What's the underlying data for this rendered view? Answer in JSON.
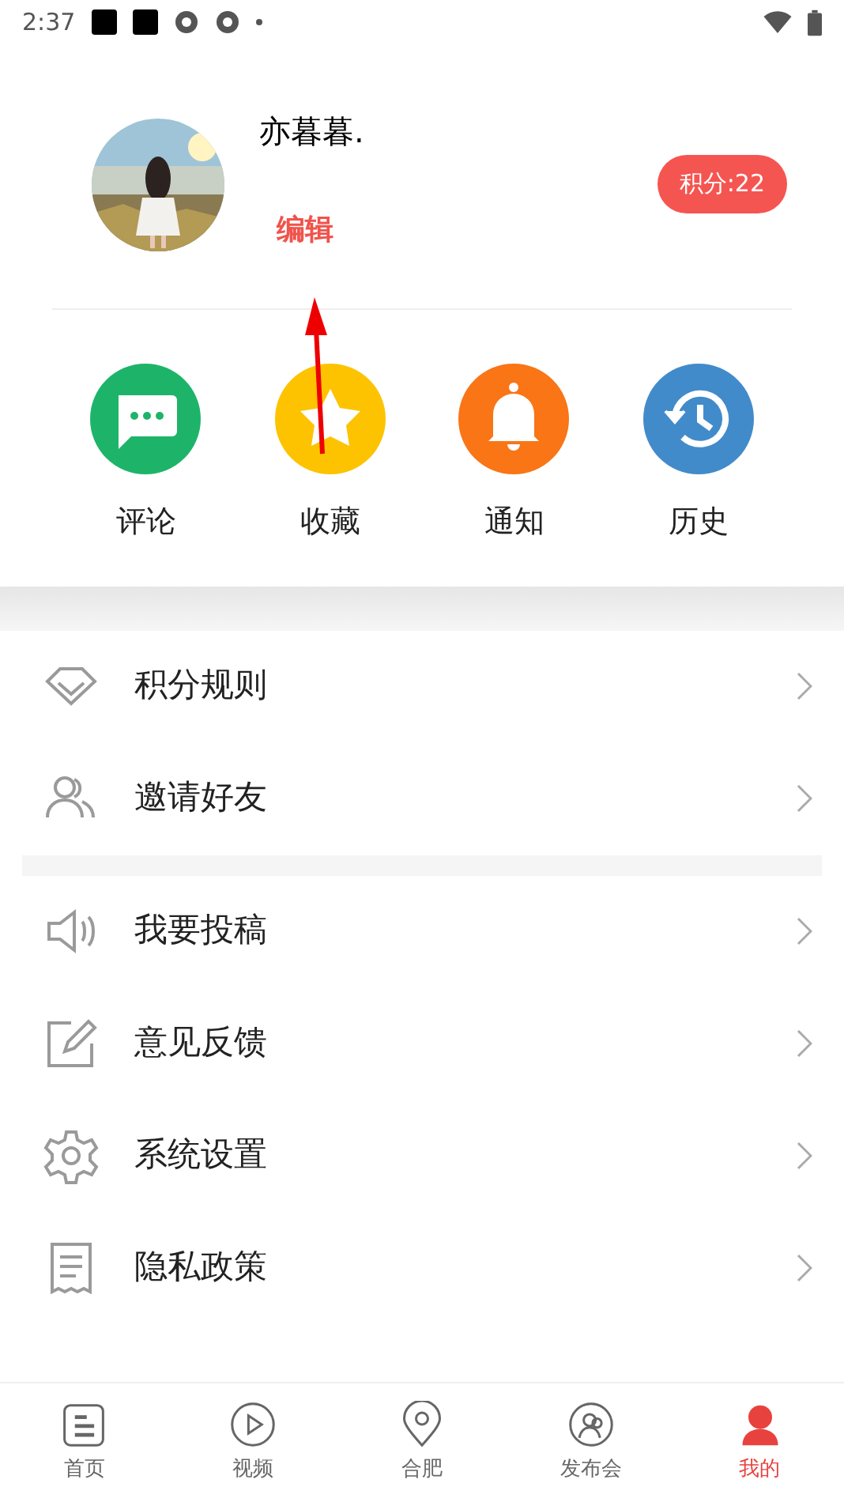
{
  "status_bar": {
    "time": "2:37"
  },
  "profile": {
    "name": "亦暮暮.",
    "edit_link": "编辑",
    "points_badge": "积分:22"
  },
  "shortcuts": [
    {
      "kind": "comment",
      "label": "评论",
      "color": "#1db46a"
    },
    {
      "kind": "star",
      "label": "收藏",
      "color": "#fdc300"
    },
    {
      "kind": "bell",
      "label": "通知",
      "color": "#f97516"
    },
    {
      "kind": "history",
      "label": "历史",
      "color": "#428bcb"
    }
  ],
  "menu_groups": [
    [
      {
        "kind": "diamond",
        "label": "积分规则"
      },
      {
        "kind": "people",
        "label": "邀请好友"
      }
    ],
    [
      {
        "kind": "speaker",
        "label": "我要投稿"
      },
      {
        "kind": "edit",
        "label": "意见反馈"
      },
      {
        "kind": "gear",
        "label": "系统设置"
      },
      {
        "kind": "doc",
        "label": "隐私政策"
      }
    ]
  ],
  "bottom_nav": [
    {
      "kind": "home",
      "label": "首页",
      "selected": false
    },
    {
      "kind": "video",
      "label": "视频",
      "selected": false
    },
    {
      "kind": "pin",
      "label": "合肥",
      "selected": false
    },
    {
      "kind": "people",
      "label": "发布会",
      "selected": false
    },
    {
      "kind": "me",
      "label": "我的",
      "selected": true
    }
  ]
}
